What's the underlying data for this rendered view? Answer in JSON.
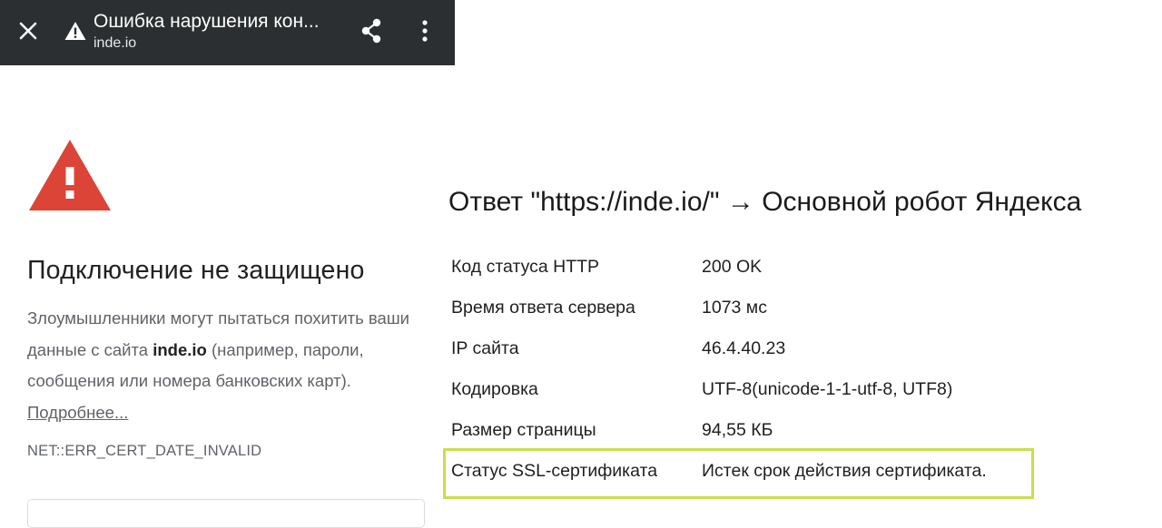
{
  "colors": {
    "toolbar_bg": "#2b2f31",
    "warning_red": "#db4437",
    "ssl_highlight": "#c6e04c"
  },
  "browser": {
    "tab_title": "Ошибка нарушения кон...",
    "tab_url": "inde.io",
    "icons": {
      "close": "close-icon",
      "warning": "warning-icon",
      "share": "share-icon",
      "menu": "more-vert-icon"
    }
  },
  "error_page": {
    "heading": "Подключение не защищено",
    "desc_before": "Злоумышленники могут пытаться похитить ваши данные с сайта ",
    "desc_site": "inde.io",
    "desc_after": " (например, пароли, сообщения или номера банковских карт). ",
    "learn_more": "Подробнее...",
    "error_code": "NET::ERR_CERT_DATE_INVALID"
  },
  "response": {
    "title": "Ответ \"https://inde.io/\" → Основной робот Яндекса",
    "rows": [
      {
        "label": "Код статуса HTTP",
        "value": "200 OK"
      },
      {
        "label": "Время ответа сервера",
        "value": "1073 мс"
      },
      {
        "label": "IP сайта",
        "value": "46.4.40.23"
      },
      {
        "label": "Кодировка",
        "value": "UTF-8(unicode-1-1-utf-8, UTF8)"
      },
      {
        "label": "Размер страницы",
        "value": "94,55 КБ"
      },
      {
        "label": "Статус SSL-сертификата",
        "value": "Истек срок действия сертификата.",
        "highlighted": true
      }
    ]
  }
}
